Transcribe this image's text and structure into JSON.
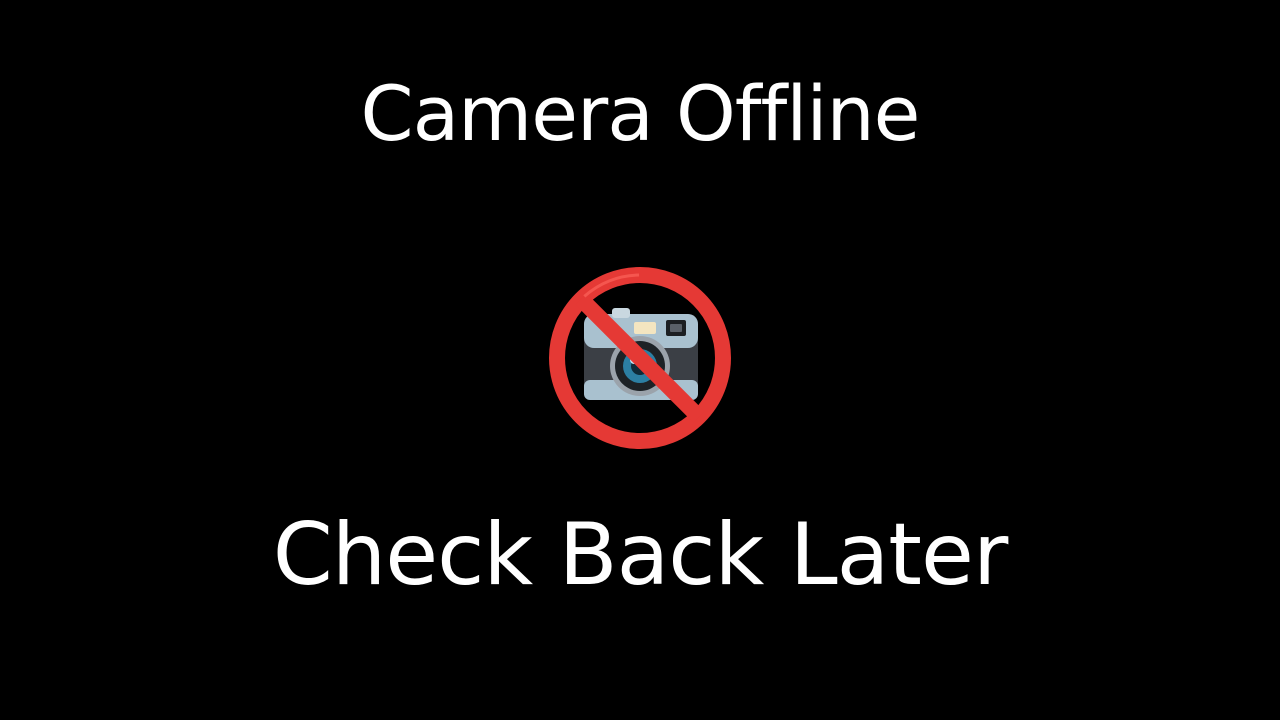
{
  "screen": {
    "title": "Camera Offline",
    "subtitle": "Check Back Later",
    "icon": "no-camera-icon",
    "background_color": "#000000",
    "text_color": "#ffffff",
    "prohibit_color": "#e53935"
  }
}
